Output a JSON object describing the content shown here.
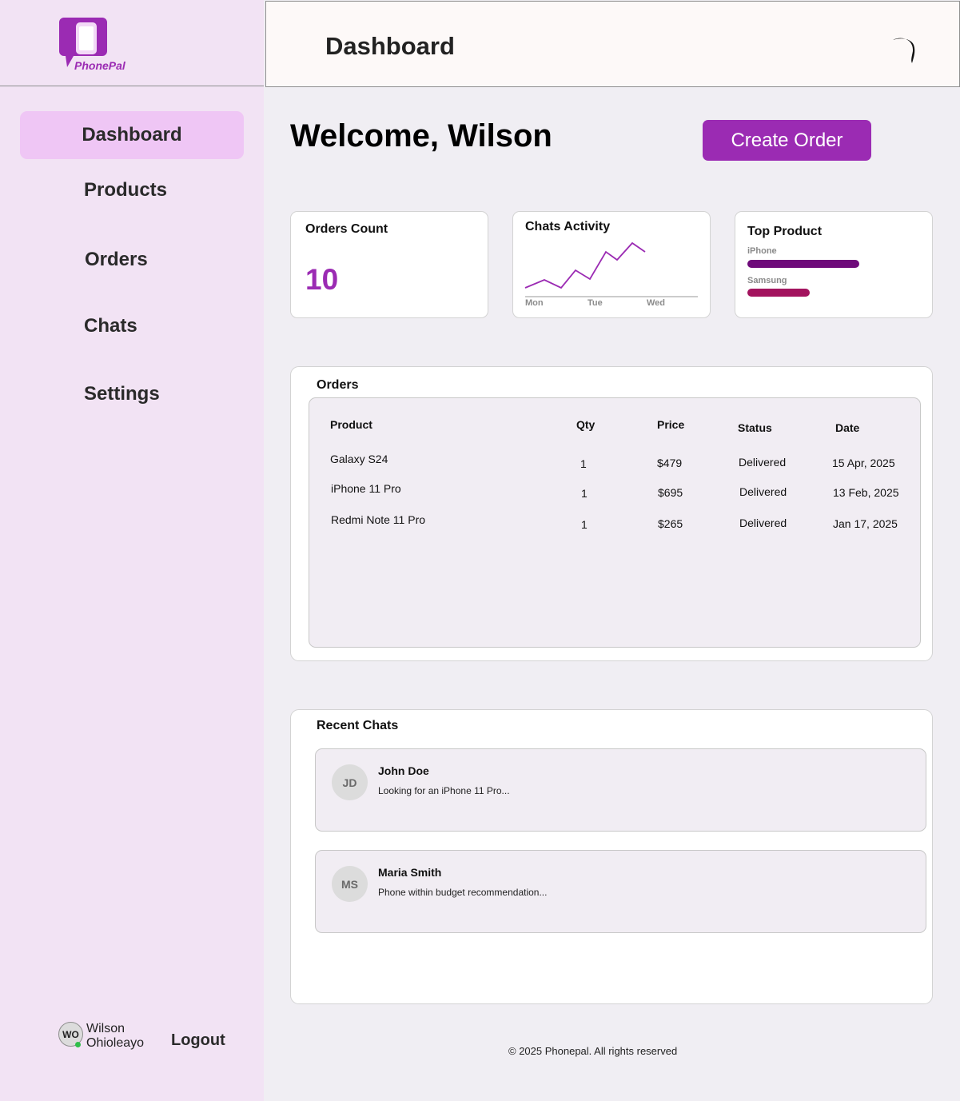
{
  "brand": {
    "name": "PhonePal",
    "color": "#9b2bb3"
  },
  "sidebar": {
    "items": [
      {
        "label": "Dashboard",
        "active": true
      },
      {
        "label": "Products"
      },
      {
        "label": "Orders"
      },
      {
        "label": "Chats"
      },
      {
        "label": "Settings"
      }
    ],
    "user": {
      "initials": "WO",
      "first_name": "Wilson",
      "last_name": "Ohioleayo",
      "online": true
    },
    "logout_label": "Logout"
  },
  "header": {
    "title": "Dashboard",
    "theme_icon": "moon-icon"
  },
  "welcome": {
    "text": "Welcome, Wilson",
    "create_label": "Create Order"
  },
  "cards": {
    "orders_count": {
      "title": "Orders Count",
      "value": "10"
    },
    "chats_activity": {
      "title": "Chats Activity",
      "days": [
        "Mon",
        "Tue",
        "Wed"
      ]
    },
    "top_product": {
      "title": "Top Product",
      "items": [
        {
          "label": "iPhone",
          "share": 1.0,
          "color": "#6e0a7a"
        },
        {
          "label": "Samsung",
          "share": 0.56,
          "color": "#a3135e"
        }
      ]
    }
  },
  "orders": {
    "title": "Orders",
    "columns": [
      "Product",
      "Qty",
      "Price",
      "Status",
      "Date"
    ],
    "rows": [
      [
        "Galaxy S24",
        "1",
        "$479",
        "Delivered",
        "15 Apr, 2025"
      ],
      [
        "iPhone 11 Pro",
        "1",
        "$695",
        "Delivered",
        "13 Feb, 2025"
      ],
      [
        "Redmi Note 11 Pro",
        "1",
        "$265",
        "Delivered",
        "Jan 17, 2025"
      ]
    ]
  },
  "recent_chats": {
    "title": "Recent Chats",
    "items": [
      {
        "initials": "JD",
        "name": "John Doe",
        "message": "Looking for an iPhone 11 Pro..."
      },
      {
        "initials": "MS",
        "name": "Maria Smith",
        "message": "Phone within budget recommendation..."
      }
    ]
  },
  "footer": {
    "text": "© 2025 Phonepal. All rights reserved"
  }
}
